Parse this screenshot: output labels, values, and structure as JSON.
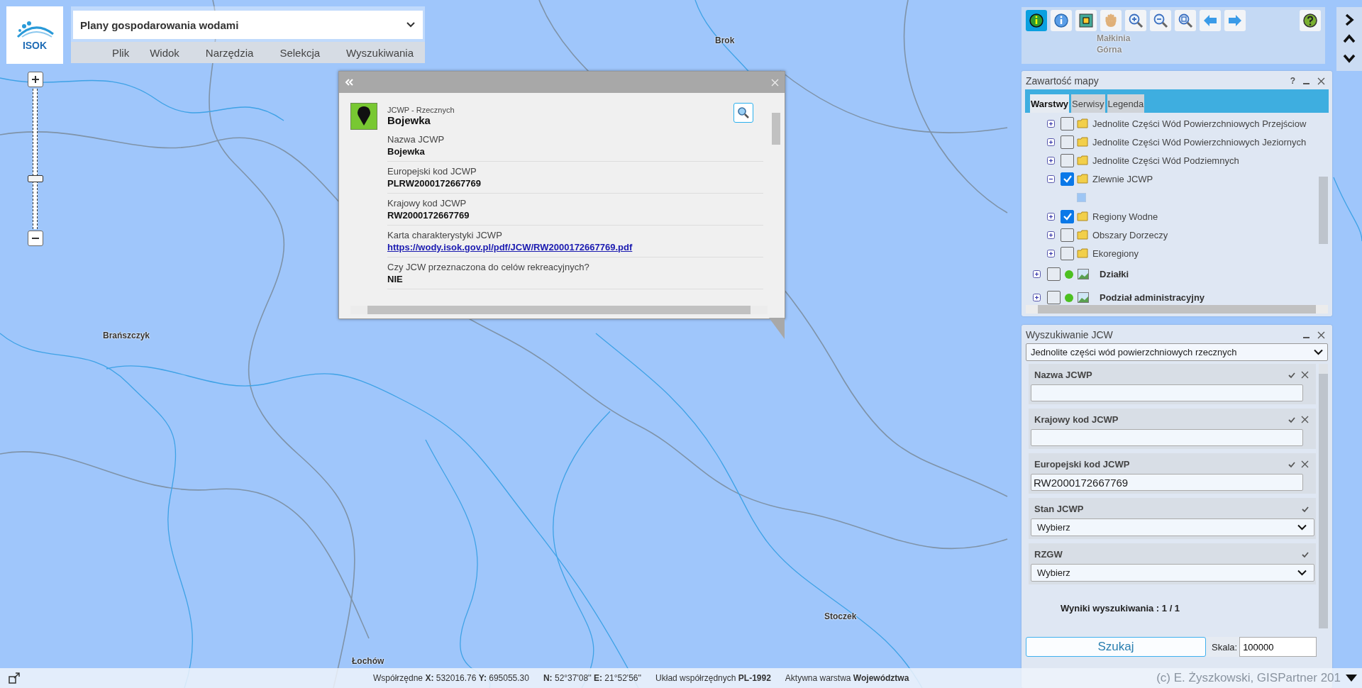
{
  "app": {
    "logo_text": "ISOK",
    "title": "Plany gospodarowania wodami",
    "menu": [
      "Plik",
      "Widok",
      "Narzędzia",
      "Selekcja",
      "Wyszukiwania"
    ]
  },
  "map_labels": [
    {
      "text": "Brok"
    },
    {
      "text": "Małkinia Górna"
    },
    {
      "text": "Brańszczyk"
    },
    {
      "text": "Stoczek"
    },
    {
      "text": "Łochów"
    }
  ],
  "toolbar": {
    "tools": [
      {
        "kind": "identify",
        "selected": true
      },
      {
        "kind": "info",
        "selected": false
      },
      {
        "kind": "select",
        "selected": false
      },
      {
        "kind": "pan",
        "selected": false
      },
      {
        "kind": "zoom-in",
        "selected": false
      },
      {
        "kind": "zoom-out",
        "selected": false
      },
      {
        "kind": "zoom-extent",
        "selected": false
      },
      {
        "kind": "back",
        "selected": false
      },
      {
        "kind": "forward",
        "selected": false
      }
    ]
  },
  "popup": {
    "layer": "JCWP - Rzecznych",
    "title": "Bojewka",
    "attributes": [
      {
        "label": "Nazwa JCWP",
        "value": "Bojewka",
        "kind": "text"
      },
      {
        "label": "Europejski kod JCWP",
        "value": "PLRW2000172667769",
        "kind": "text"
      },
      {
        "label": "Krajowy kod JCWP",
        "value": "RW2000172667769",
        "kind": "text"
      },
      {
        "label": "Karta charakterystyki JCWP",
        "value": "https://wody.isok.gov.pl/pdf/JCW/RW2000172667769.pdf",
        "kind": "link"
      },
      {
        "label": "Czy JCW przeznaczona do celów rekreacyjnych?",
        "value": "NIE",
        "kind": "text"
      }
    ]
  },
  "layers": {
    "title": "Zawartość mapy",
    "help": "?",
    "tabs": [
      {
        "label": "Warstwy",
        "selected": true
      },
      {
        "label": "Serwisy",
        "selected": false
      },
      {
        "label": "Legenda",
        "selected": false
      }
    ],
    "items": [
      {
        "label": "Jednolite Części Wód Powierzchniowych Przejściow",
        "kind": "folder",
        "checked": false,
        "expanded": false
      },
      {
        "label": "Jednolite Części Wód Powierzchniowych Jeziornych",
        "kind": "folder",
        "checked": false,
        "expanded": false
      },
      {
        "label": "Jednolite Części Wód Podziemnych",
        "kind": "folder",
        "checked": false,
        "expanded": false
      },
      {
        "label": "Zlewnie JCWP",
        "kind": "folder",
        "checked": true,
        "expanded": true,
        "children": [
          {
            "kind": "swatch"
          }
        ]
      },
      {
        "label": "Regiony Wodne",
        "kind": "folder",
        "checked": true,
        "expanded": false
      },
      {
        "label": "Obszary Dorzeczy",
        "kind": "folder",
        "checked": false,
        "expanded": false
      },
      {
        "label": "Ekoregiony",
        "kind": "folder",
        "checked": false,
        "expanded": false
      },
      {
        "label": "Działki",
        "kind": "service",
        "checked": false,
        "expanded": false
      },
      {
        "label": "Podział administracyjny",
        "kind": "service",
        "checked": false,
        "expanded": false
      }
    ]
  },
  "search": {
    "title": "Wyszukiwanie JCW",
    "type": "Jednolite części wód powierzchniowych rzecznych",
    "fields": [
      {
        "label": "Nazwa JCWP",
        "kind": "text"
      },
      {
        "label": "Krajowy kod JCWP",
        "kind": "text"
      },
      {
        "label": "Europejski kod JCWP",
        "kind": "text",
        "value": "RW2000172667769"
      },
      {
        "label": "Stan JCWP",
        "kind": "select",
        "value": "Wybierz"
      },
      {
        "label": "RZGW",
        "kind": "select",
        "value": "Wybierz"
      }
    ],
    "results": "Wyniki wyszukiwania : 1 / 1",
    "button": "Szukaj",
    "scale_label": "Skala:",
    "scale_value": "100000"
  },
  "status_bar": {
    "segments": [
      "Współrzędne **X:** 532016.76 **Y:** 695055.30",
      "**N:** 52°37'08'' **E:** 21°52'56''",
      "Układ współrzędnych **PL-1992**",
      "Aktywna warstwa **Województwa**"
    ],
    "copyright": "(c) E. Żyszkowski, GISPartner 201"
  }
}
